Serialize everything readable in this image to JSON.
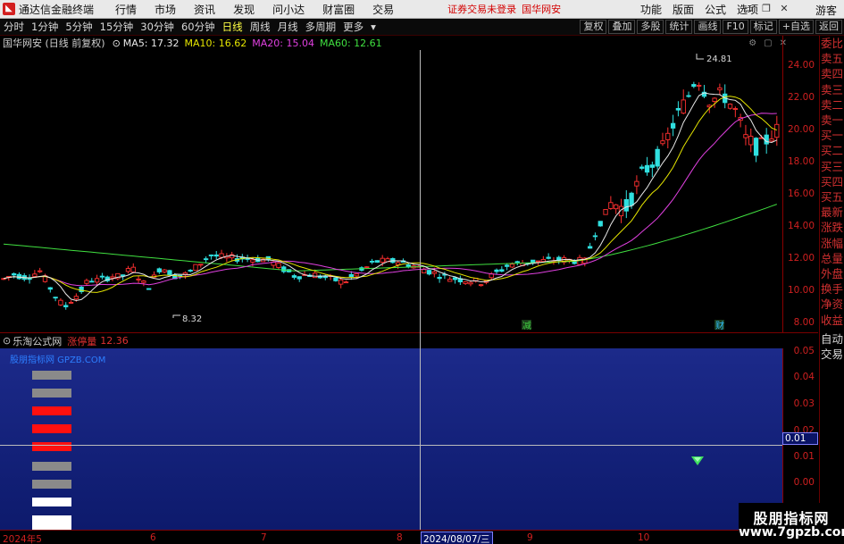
{
  "app": {
    "title": "通达信金融终端",
    "menu": [
      "行情",
      "市场",
      "资讯",
      "发现",
      "问小达",
      "财富圈",
      "交易"
    ],
    "status_left": "证券交易未登录",
    "status_right": "国华网安",
    "right_menu": [
      "功能",
      "版面",
      "公式",
      "选项"
    ],
    "guest": "游客"
  },
  "toolbar": {
    "periods": [
      "分时",
      "1分钟",
      "5分钟",
      "15分钟",
      "30分钟",
      "60分钟",
      "日线",
      "周线",
      "月线",
      "多周期",
      "更多"
    ],
    "active_period": "日线",
    "right_buttons": [
      "复权",
      "叠加",
      "多股",
      "统计",
      "画线",
      "F10",
      "标记",
      "+自选",
      "返回"
    ]
  },
  "chart": {
    "stock_label": "国华网安 (日线 前复权)",
    "ma5": "MA5: 17.32",
    "ma10": "MA10: 16.62",
    "ma20": "MA20: 15.04",
    "ma60": "MA60: 12.61",
    "high_label": "24.81",
    "low_label": "8.32",
    "y_ticks": [
      "24.00",
      "22.00",
      "20.00",
      "18.00",
      "16.00",
      "14.00",
      "12.00",
      "10.00",
      "8.00"
    ],
    "marker_jian": "减",
    "marker_cai": "财"
  },
  "right_panel": [
    "委比",
    "卖五",
    "卖四",
    "卖三",
    "卖二",
    "卖一",
    "买一",
    "买二",
    "买三",
    "买四",
    "买五",
    "最新",
    "涨跌",
    "涨幅",
    "总量",
    "外盘",
    "换手",
    "净资",
    "收益"
  ],
  "right_panel_auto": [
    "自动",
    "交易"
  ],
  "sub": {
    "name": "乐淘公式网",
    "indicator": "涨停量",
    "value": "12.36",
    "watermark": "股朋指标网 GPZB.COM",
    "y_ticks": [
      "0.05",
      "0.04",
      "0.03",
      "0.02",
      "0.01",
      "0.00"
    ],
    "cross_value": "0.01"
  },
  "time_axis": {
    "labels": [
      "2024年5",
      "6",
      "7",
      "8",
      "9",
      "10"
    ],
    "cross_date": "2024/08/07/三"
  },
  "badge": {
    "line1": "股朋指标网",
    "line2": "www.7gpzb.com"
  },
  "colors": {
    "up": "#ff3030",
    "down": "#30e0e0",
    "ma5": "#e8e8e8",
    "ma10": "#e4e400",
    "ma20": "#e040e0",
    "ma60": "#40e040"
  }
}
